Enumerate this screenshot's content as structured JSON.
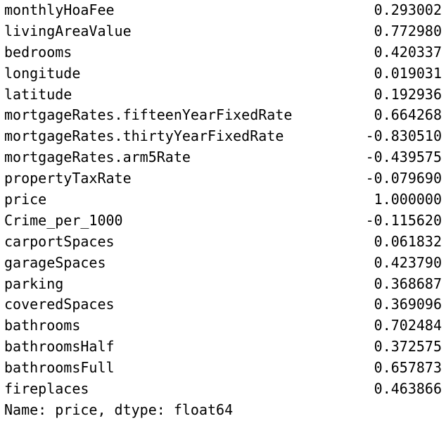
{
  "series_output": {
    "rows": [
      {
        "name": "monthlyHoaFee",
        "value": "0.293002"
      },
      {
        "name": "livingAreaValue",
        "value": "0.772980"
      },
      {
        "name": "bedrooms",
        "value": "0.420337"
      },
      {
        "name": "longitude",
        "value": "0.019031"
      },
      {
        "name": "latitude",
        "value": "0.192936"
      },
      {
        "name": "mortgageRates.fifteenYearFixedRate",
        "value": "0.664268"
      },
      {
        "name": "mortgageRates.thirtyYearFixedRate",
        "value": "-0.830510"
      },
      {
        "name": "mortgageRates.arm5Rate",
        "value": "-0.439575"
      },
      {
        "name": "propertyTaxRate",
        "value": "-0.079690"
      },
      {
        "name": "price",
        "value": "1.000000"
      },
      {
        "name": "Crime_per_1000",
        "value": "-0.115620"
      },
      {
        "name": "carportSpaces",
        "value": "0.061832"
      },
      {
        "name": "garageSpaces",
        "value": "0.423790"
      },
      {
        "name": "parking",
        "value": "0.368687"
      },
      {
        "name": "coveredSpaces",
        "value": "0.369096"
      },
      {
        "name": "bathrooms",
        "value": "0.702484"
      },
      {
        "name": "bathroomsHalf",
        "value": "0.372575"
      },
      {
        "name": "bathroomsFull",
        "value": "0.657873"
      },
      {
        "name": "fireplaces",
        "value": "0.463866"
      }
    ],
    "footer": "Name: price, dtype: float64"
  }
}
